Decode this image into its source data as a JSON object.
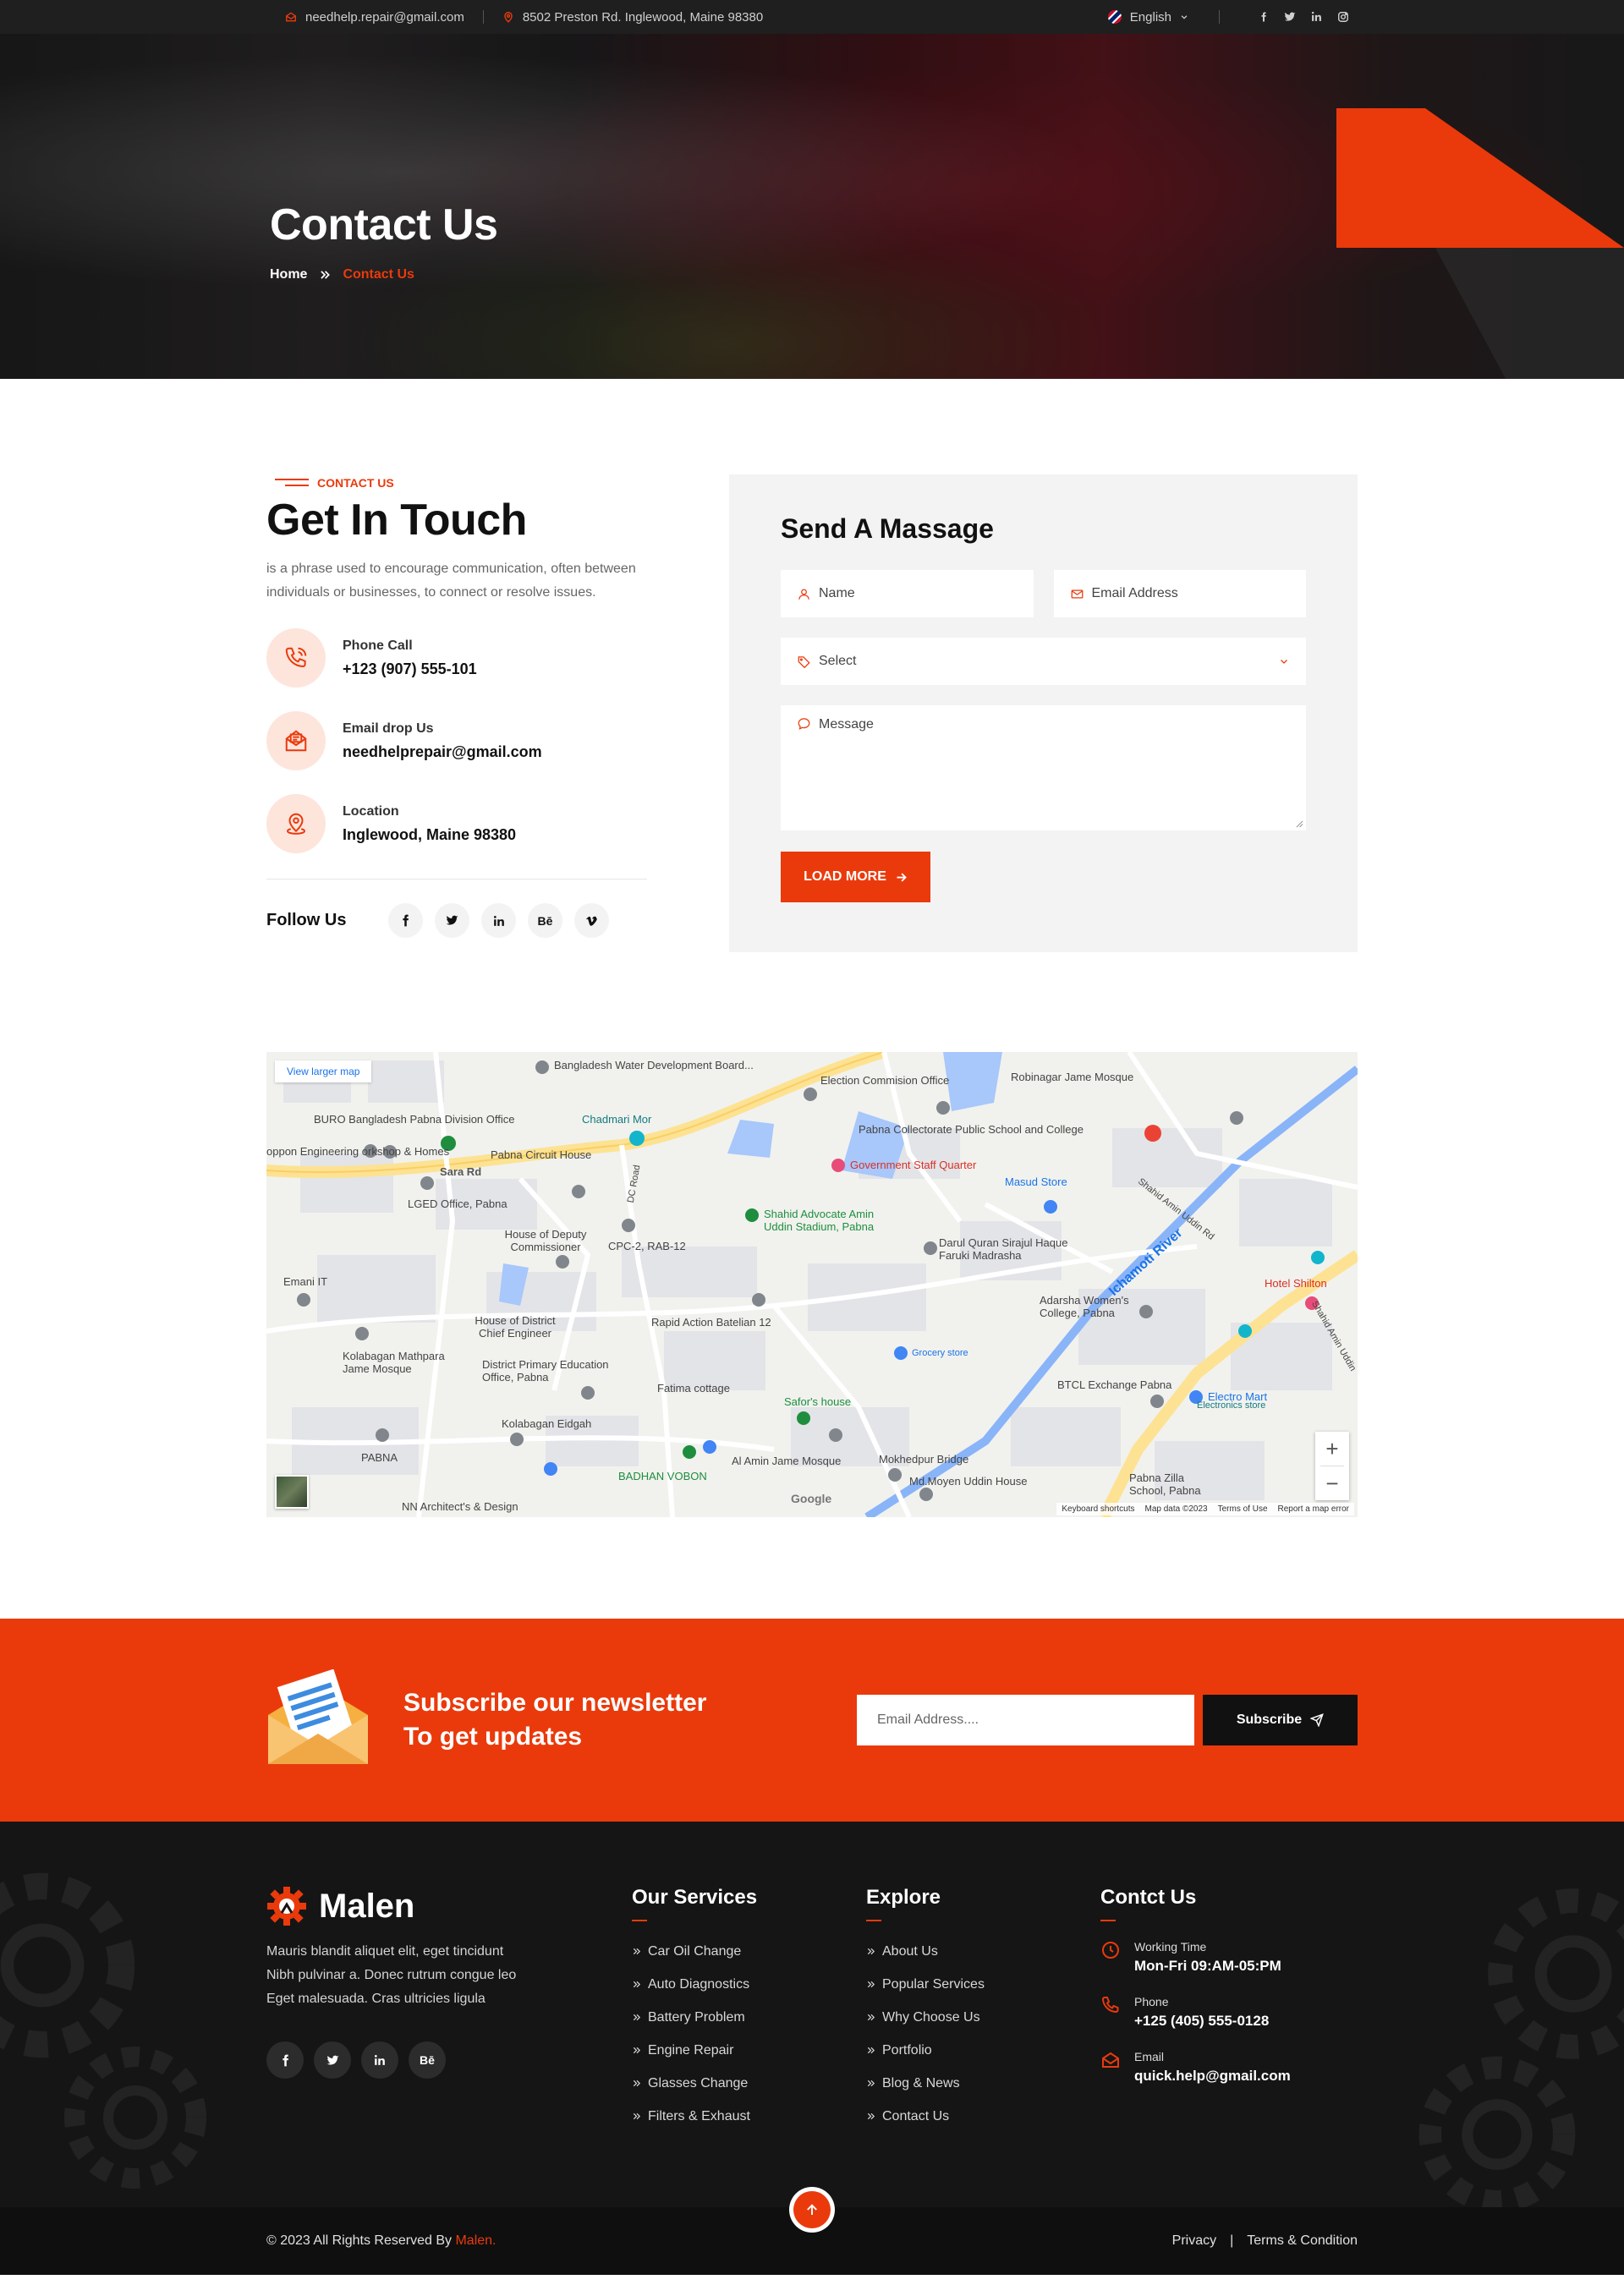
{
  "topbar": {
    "email": "needhelp.repair@gmail.com",
    "address": "8502 Preston Rd. Inglewood, Maine 98380",
    "language": "English"
  },
  "hero": {
    "title": "Contact Us",
    "breadcrumb_home": "Home",
    "breadcrumb_current": "Contact Us"
  },
  "contact": {
    "tag": "CONTACT US",
    "title": "Get In Touch",
    "description": "is a phrase used to encourage communication, often between individuals or businesses, to connect or resolve issues.",
    "items": [
      {
        "label": "Phone Call",
        "value": "+123 (907) 555-101",
        "icon": "phone-icon"
      },
      {
        "label": "Email drop Us",
        "value": "needhelprepair@gmail.com",
        "icon": "mail-open-icon"
      },
      {
        "label": "Location",
        "value": "Inglewood, Maine 98380",
        "icon": "map-pin-icon"
      }
    ],
    "follow_title": "Follow Us",
    "social": [
      "f",
      "t",
      "in",
      "Bē",
      "v"
    ]
  },
  "form": {
    "title": "Send A Massage",
    "name_placeholder": "Name",
    "email_placeholder": "Email Address",
    "select_value": "Select",
    "message_placeholder": "Message",
    "submit_label": "LOAD MORE"
  },
  "map": {
    "view_larger": "View larger map",
    "labels": [
      "Bangladesh Water Development Board...",
      "Election Commision Office",
      "Robinagar Jame Mosque",
      "BURO Bangladesh Pabna Division Office",
      "Chadmari Mor",
      "Pabna Collectorate Public School and College",
      "oppon Engineering orkshop & Homes",
      "Sara Rd",
      "Pabna Circuit House",
      "Government Staff Quarter",
      "LGED Office, Pabna",
      "Masud Store",
      "Shahid Amin Uddin Rd",
      "DC Road",
      "Shahid Advocate Amin Uddin Stadium, Pabna",
      "House of Deputy Commissioner",
      "CPC-2, RAB-12",
      "Darul Quran Sirajul Haque Faruki Madrasha",
      "Ichamoti River",
      "Hotel Shilton",
      "Emani IT",
      "House of District Chief Engineer",
      "Rapid Action Batelian 12",
      "Adarsha Women's College, Pabna",
      "Kolabagan Mathpara Jame Mosque",
      "District Primary Education Office, Pabna",
      "Grocery store",
      "Electro Mart",
      "Fatima cottage",
      "Safor's house",
      "BTCL Exchange Pabna",
      "Kolabagan Eidgah",
      "PABNA",
      "Al Amin Jame Mosque",
      "Mokhedpur Bridge",
      "BADHAN VOBON",
      "Md.Moyen Uddin House",
      "Pabna Zilla School, Pabna",
      "NN Architect's & Design",
      "Electronics store",
      "Shahid Amin Uddin"
    ],
    "zoom_in": "+",
    "zoom_out": "−",
    "footer": [
      "Keyboard shortcuts",
      "Map data ©2023",
      "Terms of Use",
      "Report a map error"
    ],
    "google": "Google"
  },
  "newsletter": {
    "line1": "Subscribe our newsletter",
    "line2": "To get updates",
    "placeholder": "Email Address....",
    "button": "Subscribe"
  },
  "footer": {
    "brand": "Malen",
    "about": "Mauris blandit aliquet elit, eget tincidunt Nibh pulvinar a. Donec rutrum congue leo Eget malesuada. Cras ultricies ligula",
    "social": [
      "f",
      "t",
      "in",
      "Bē"
    ],
    "services_title": "Our Services",
    "services": [
      "Car Oil Change",
      "Auto Diagnostics",
      "Battery Problem",
      "Engine Repair",
      "Glasses Change",
      "Filters & Exhaust"
    ],
    "explore_title": "Explore",
    "explore": [
      "About Us",
      "Popular Services",
      "Why Choose Us",
      "Portfolio",
      "Blog & News",
      "Contact Us"
    ],
    "contact_title": "Contct Us",
    "contact_items": [
      {
        "label": "Working Time",
        "value": "Mon-Fri 09:AM-05:PM",
        "icon": "clock-icon"
      },
      {
        "label": "Phone",
        "value": "+125 (405) 555-0128",
        "icon": "phone-icon"
      },
      {
        "label": "Email",
        "value": "quick.help@gmail.com",
        "icon": "mail-icon"
      }
    ],
    "copyright_prefix": "© 2023 All Rights Reserved By",
    "copyright_brand": "Malen.",
    "privacy": "Privacy",
    "sep": "|",
    "terms": "Terms & Condition"
  },
  "colors": {
    "accent": "#ea3a0c",
    "dark": "#151515"
  }
}
